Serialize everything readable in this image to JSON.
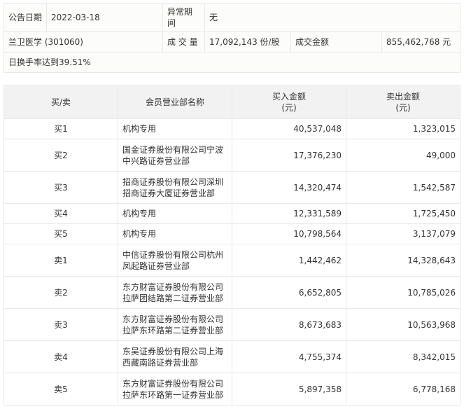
{
  "info": {
    "date_label": "公告日期",
    "date_value": "2022-03-18",
    "period_label": "异常期间",
    "period_value": "无",
    "stock": "兰卫医学 (301060)",
    "volume_label": "成 交 量",
    "volume_value": "17,092,143 份/股",
    "amount_label": "成交金额",
    "amount_value": "855,462,768 元",
    "reason": "日换手率达到39.51%"
  },
  "table": {
    "headers": {
      "side": "买/卖",
      "member": "会员营业部名称",
      "buy": "买入金额",
      "buy_unit": "(元)",
      "sell": "卖出金额",
      "sell_unit": "(元)"
    },
    "rows": [
      {
        "side": "买1",
        "member": "机构专用",
        "buy": "40,537,048",
        "sell": "1,323,015"
      },
      {
        "side": "买2",
        "member": "国金证券股份有限公司宁波中兴路证券营业部",
        "buy": "17,376,230",
        "sell": "49,000"
      },
      {
        "side": "买3",
        "member": "招商证券股份有限公司深圳招商证券大厦证券营业部",
        "buy": "14,320,474",
        "sell": "1,542,587"
      },
      {
        "side": "买4",
        "member": "机构专用",
        "buy": "12,331,589",
        "sell": "1,725,450"
      },
      {
        "side": "买5",
        "member": "机构专用",
        "buy": "10,798,564",
        "sell": "3,137,079"
      },
      {
        "side": "卖1",
        "member": "中信证券股份有限公司杭州凤起路证券营业部",
        "buy": "1,442,462",
        "sell": "14,328,643"
      },
      {
        "side": "卖2",
        "member": "东方财富证券股份有限公司拉萨团结路第二证券营业部",
        "buy": "6,652,805",
        "sell": "10,785,026"
      },
      {
        "side": "卖3",
        "member": "东方财富证券股份有限公司拉萨东环路第二证券营业部",
        "buy": "8,673,683",
        "sell": "10,563,968"
      },
      {
        "side": "卖4",
        "member": "东吴证券股份有限公司上海西藏南路证券营业部",
        "buy": "4,755,374",
        "sell": "8,342,015"
      },
      {
        "side": "卖5",
        "member": "东方财富证券股份有限公司拉萨东环路第一证券营业部",
        "buy": "5,897,358",
        "sell": "6,778,168"
      }
    ]
  }
}
